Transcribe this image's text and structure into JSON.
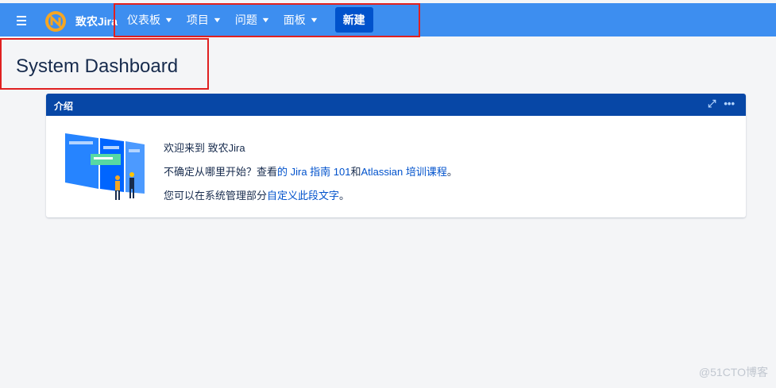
{
  "nav": {
    "brand": "致农Jira",
    "items": [
      {
        "label": "仪表板"
      },
      {
        "label": "项目"
      },
      {
        "label": "问题"
      },
      {
        "label": "面板"
      }
    ],
    "create_label": "新建",
    "accent": "#3d8ef0",
    "create_color": "#0052cc"
  },
  "page": {
    "title": "System Dashboard"
  },
  "gadget": {
    "title": "介绍",
    "line1": "欢迎来到 致农Jira",
    "line2_prefix": "不确定从哪里开始？查看",
    "line2_link1": "的 Jira 指南 101",
    "line2_mid": "和",
    "line2_link2": "Atlassian 培训课程",
    "line2_suffix": "。",
    "line3_prefix": "您可以在系统管理部分",
    "line3_link": "自定义此段文字",
    "line3_suffix": "。",
    "header_color": "#0747a6"
  },
  "watermark": "@51CTO博客",
  "icons": [
    "menu-icon",
    "jira-logo-icon",
    "chevron-down-icon",
    "expand-icon",
    "more-icon"
  ]
}
